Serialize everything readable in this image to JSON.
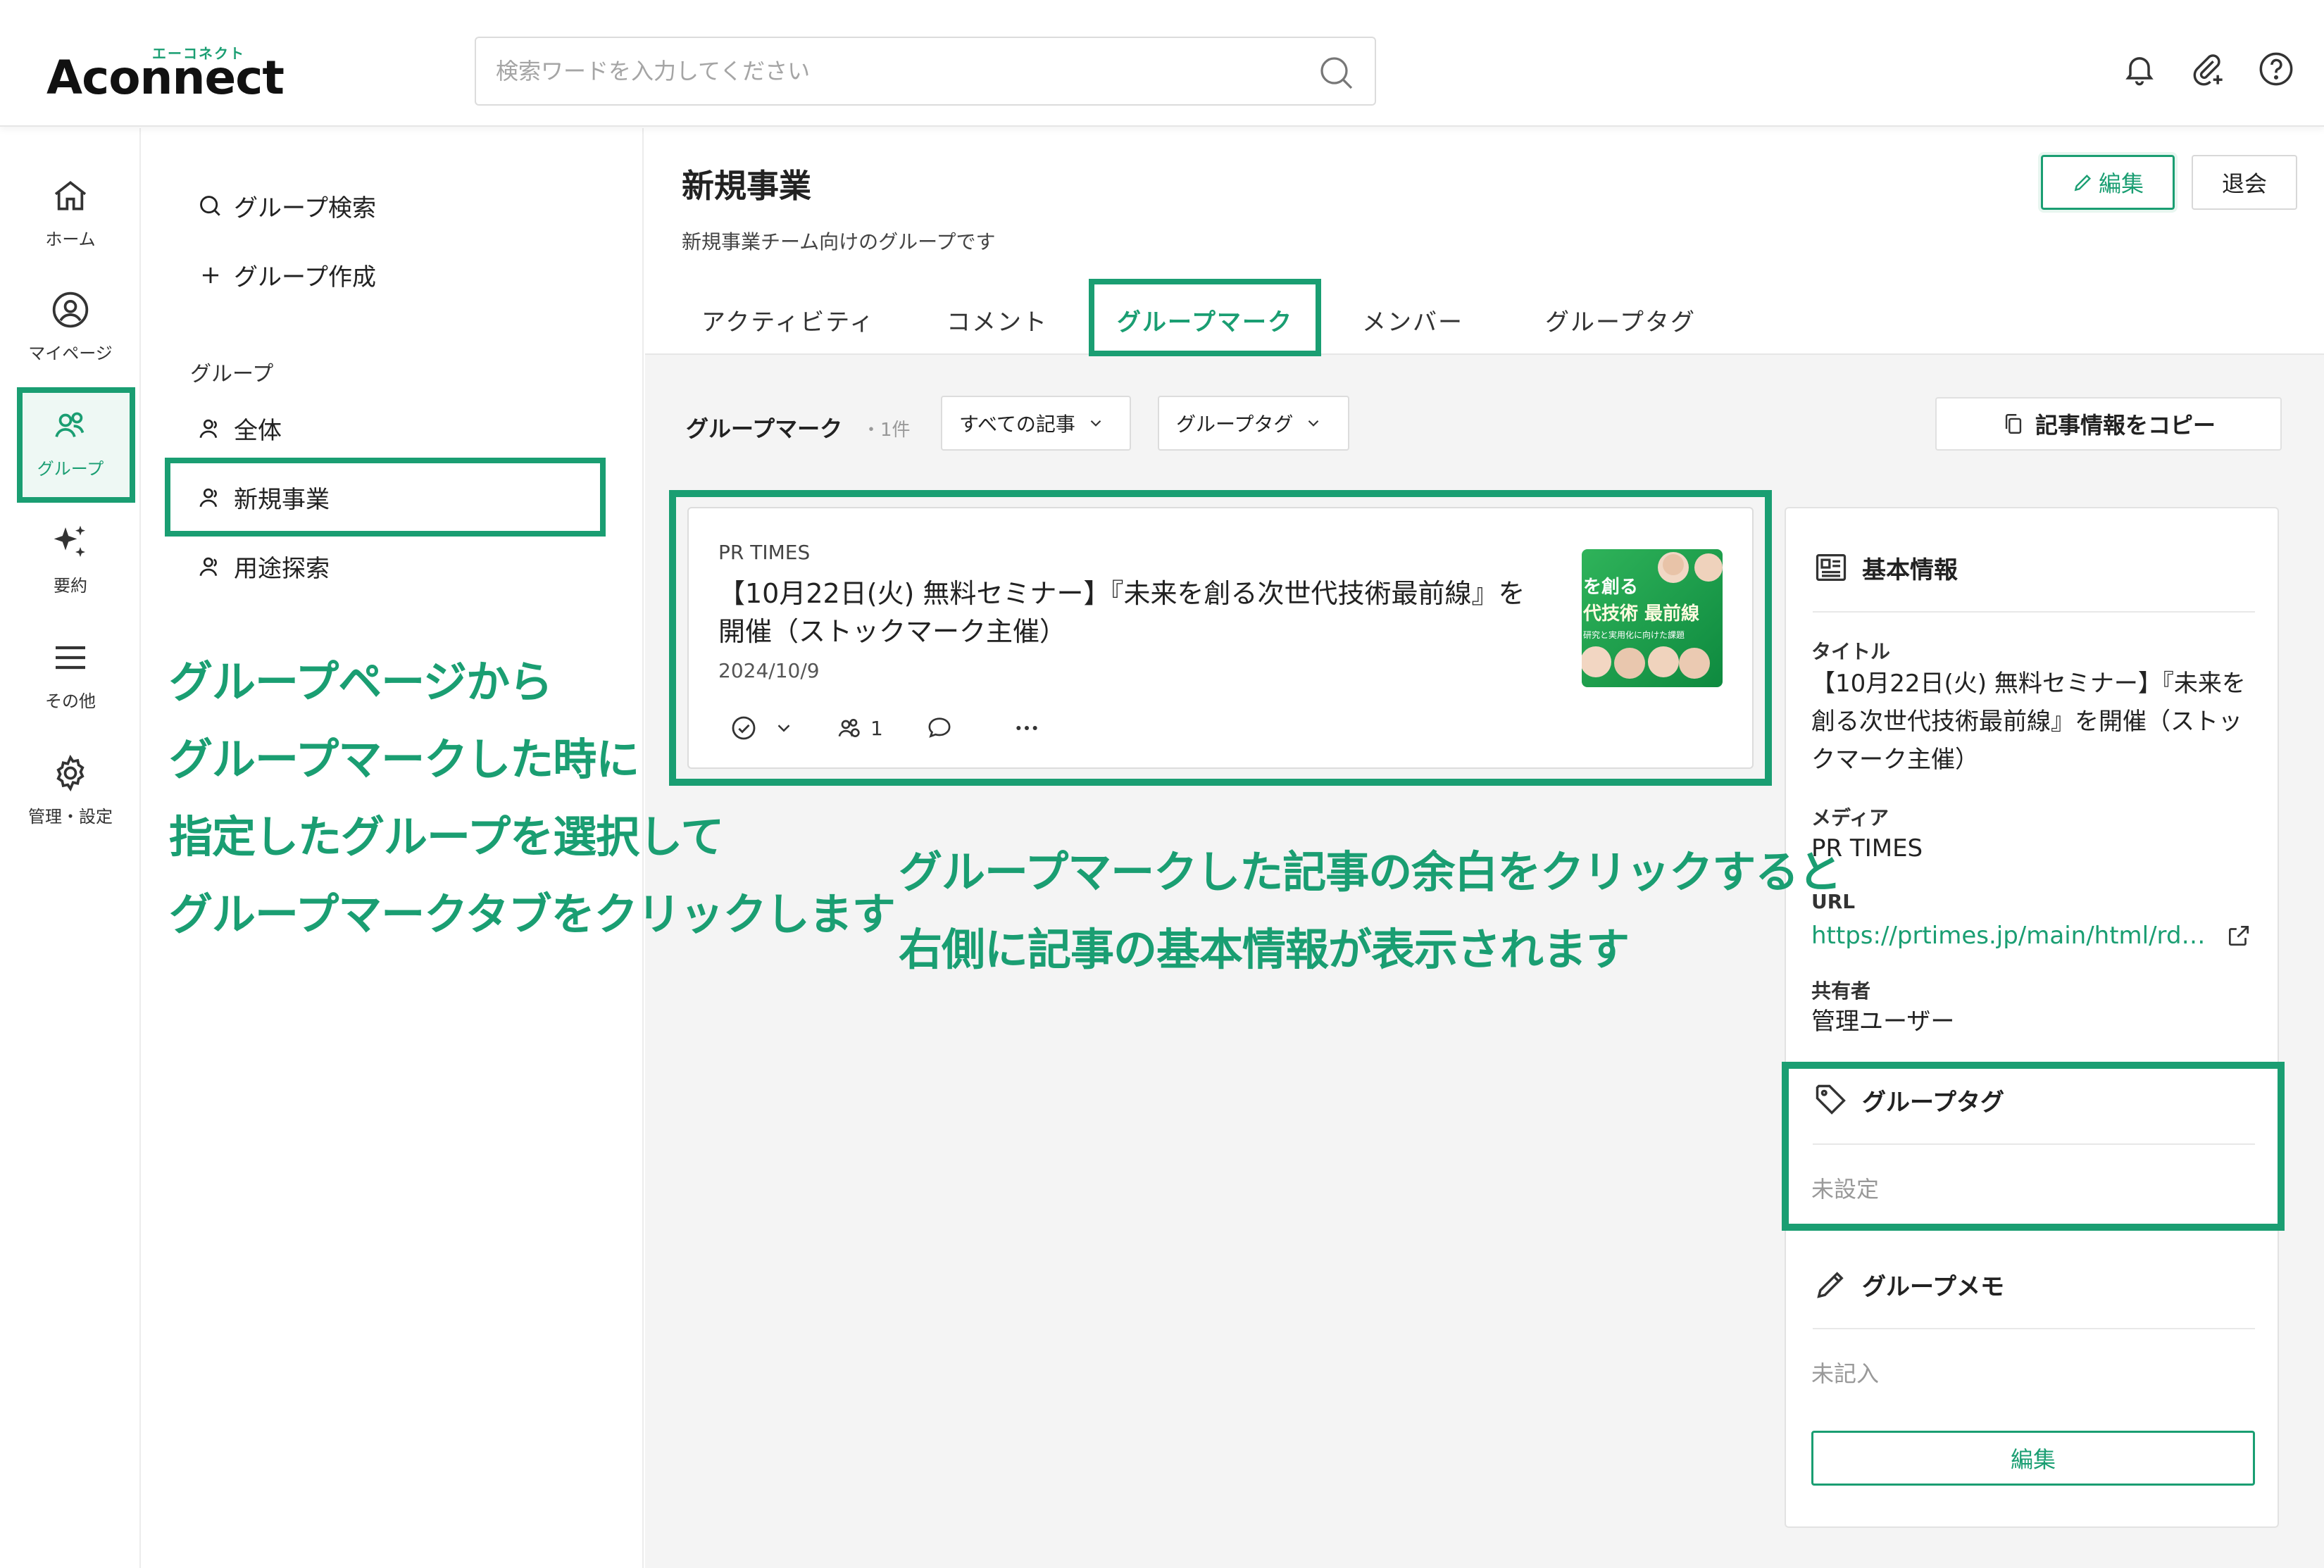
{
  "app": {
    "logo_main": "Aconnect",
    "logo_kana": "エーコネクト"
  },
  "search": {
    "placeholder": "検索ワードを入力してください"
  },
  "rail": {
    "items": [
      {
        "label": "ホーム"
      },
      {
        "label": "マイページ"
      },
      {
        "label": "グループ"
      },
      {
        "label": "要約"
      },
      {
        "label": "その他"
      },
      {
        "label": "管理・設定"
      }
    ]
  },
  "group_panel": {
    "search_label": "グループ検索",
    "create_label": "グループ作成",
    "section_label": "グループ",
    "items": [
      {
        "label": "全体"
      },
      {
        "label": "新規事業"
      },
      {
        "label": "用途探索"
      }
    ]
  },
  "annotations": {
    "left_lines": [
      "グループページから",
      "グループマークした時に",
      "指定したグループを選択して",
      "グループマークタブをクリックします"
    ],
    "center_lines": [
      "グループマークした記事の余白をクリックすると",
      "右側に記事の基本情報が表示されます"
    ]
  },
  "group": {
    "title": "新規事業",
    "description": "新規事業チーム向けのグループです",
    "edit_label": "編集",
    "leave_label": "退会"
  },
  "tabs": [
    {
      "label": "アクティビティ"
    },
    {
      "label": "コメント"
    },
    {
      "label": "グループマーク"
    },
    {
      "label": "メンバー"
    },
    {
      "label": "グループタグ"
    }
  ],
  "filter": {
    "label": "グループマーク",
    "count": "・1件",
    "dropdown_articles": "すべての記事",
    "dropdown_tags": "グループタグ",
    "copy_label": "記事情報をコピー"
  },
  "article": {
    "media": "PR TIMES",
    "title": "【10月22日(火) 無料セミナー】『未来を創る次世代技術最前線』を開催（ストックマーク主催）",
    "date": "2024/10/9",
    "share_count": "1",
    "thumb_line1": "を創る",
    "thumb_line2": "代技術 最前線",
    "thumb_line3": "研究と実用化に向けた課題"
  },
  "info": {
    "basic_heading": "基本情報",
    "title_label": "タイトル",
    "title_value": "【10月22日(火) 無料セミナー】『未来を創る次世代技術最前線』を開催（ストックマーク主催）",
    "media_label": "メディア",
    "media_value": "PR TIMES",
    "url_label": "URL",
    "url_value": "https://prtimes.jp/main/html/rd/…",
    "sharer_label": "共有者",
    "sharer_value": "管理ユーザー",
    "tag_heading": "グループタグ",
    "tag_empty": "未設定",
    "memo_heading": "グループメモ",
    "memo_empty": "未記入",
    "memo_edit_label": "編集"
  },
  "colors": {
    "accent": "#1a9e72",
    "background": "#f4f4f4"
  }
}
